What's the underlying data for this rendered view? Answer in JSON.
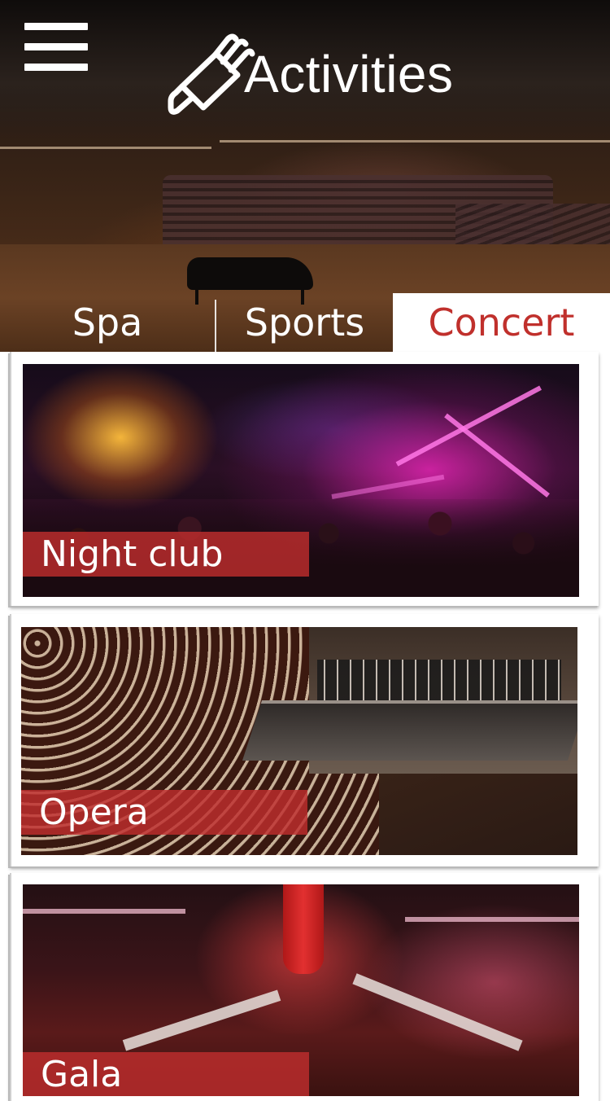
{
  "header": {
    "title": "Activities",
    "menu_icon": "hamburger-menu-icon",
    "title_icon": "golf-bag-icon"
  },
  "tabs": [
    {
      "label": "Spa",
      "active": false
    },
    {
      "label": "Sports",
      "active": false
    },
    {
      "label": "Concert",
      "active": true
    }
  ],
  "colors": {
    "accent": "#c0302c",
    "label_bar": "#be2d2d",
    "tab_text": "#ffffff",
    "background": "#ffffff"
  },
  "cards": [
    {
      "label": "Night club",
      "image": "night-club-photo"
    },
    {
      "label": "Opera",
      "image": "opera-photo"
    },
    {
      "label": "Gala",
      "image": "gala-photo"
    }
  ]
}
